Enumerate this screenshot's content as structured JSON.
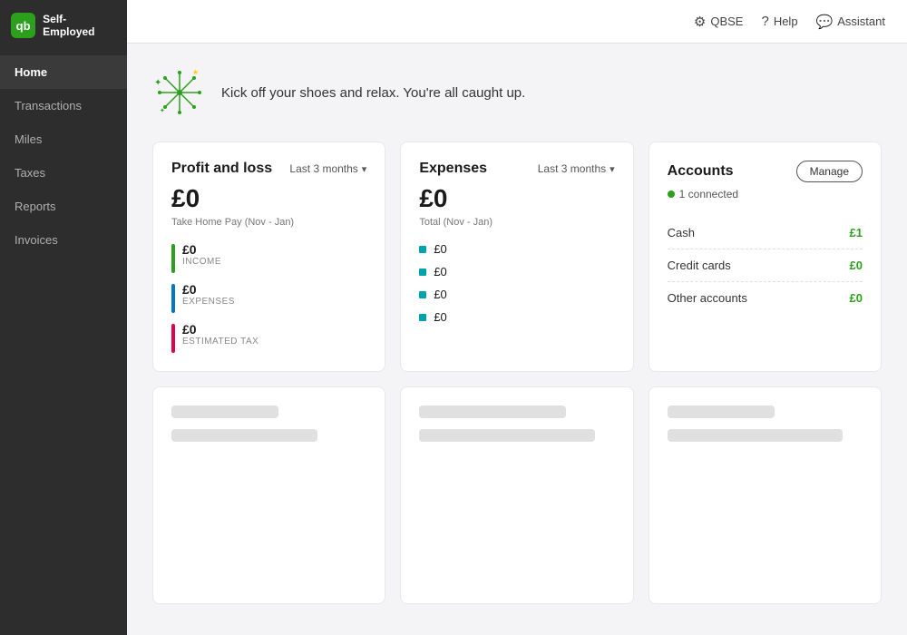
{
  "sidebar": {
    "logo_text": "Self-Employed",
    "logo_abbr": "qb",
    "items": [
      {
        "id": "home",
        "label": "Home",
        "active": true
      },
      {
        "id": "transactions",
        "label": "Transactions",
        "active": false
      },
      {
        "id": "miles",
        "label": "Miles",
        "active": false
      },
      {
        "id": "taxes",
        "label": "Taxes",
        "active": false
      },
      {
        "id": "reports",
        "label": "Reports",
        "active": false
      },
      {
        "id": "invoices",
        "label": "Invoices",
        "active": false
      }
    ]
  },
  "topbar": {
    "qbse_label": "QBSE",
    "help_label": "Help",
    "assistant_label": "Assistant"
  },
  "welcome": {
    "message": "Kick off your shoes and relax. You're all caught up."
  },
  "profit_loss": {
    "title": "Profit and loss",
    "period": "Last 3 months",
    "amount": "£0",
    "subtitle": "Take Home Pay (Nov - Jan)",
    "income": {
      "value": "£0",
      "label": "INCOME"
    },
    "expenses": {
      "value": "£0",
      "label": "EXPENSES"
    },
    "estimated_tax": {
      "value": "£0",
      "label": "ESTIMATED TAX"
    }
  },
  "expenses_card": {
    "title": "Expenses",
    "period": "Last 3 months",
    "amount": "£0",
    "subtitle": "Total (Nov - Jan)",
    "items": [
      "£0",
      "£0",
      "£0",
      "£0"
    ]
  },
  "accounts": {
    "title": "Accounts",
    "manage_label": "Manage",
    "connected_count": "1 connected",
    "rows": [
      {
        "name": "Cash",
        "amount": "£1"
      },
      {
        "name": "Credit cards",
        "amount": "£0"
      },
      {
        "name": "Other accounts",
        "amount": "£0"
      }
    ]
  }
}
